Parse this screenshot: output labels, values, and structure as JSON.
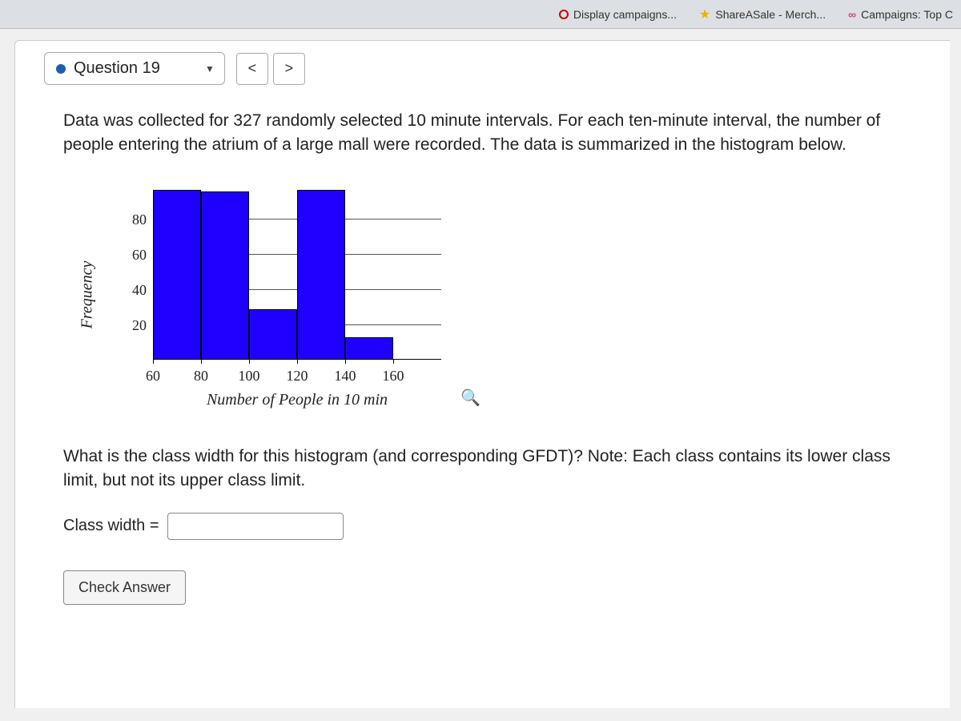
{
  "bookmarks": [
    {
      "label": "Display campaigns...",
      "icon": "circle"
    },
    {
      "label": "ShareASale - Merch...",
      "icon": "star"
    },
    {
      "label": "Campaigns: Top C",
      "icon": "inf"
    }
  ],
  "question": {
    "label": "Question 19",
    "prompt": "Data was collected for 327 randomly selected 10 minute intervals. For each ten-minute interval, the number of people entering the atrium of a large mall were recorded. The data is summarized in the histogram below.",
    "followup": "What is the class width for this histogram (and corresponding GFDT)? Note: Each class contains its lower class limit, but not its upper class limit.",
    "answer_label": "Class width =",
    "check_label": "Check Answer"
  },
  "chart_data": {
    "type": "bar",
    "title": "",
    "xlabel": "Number of People in 10 min",
    "ylabel": "Frequency",
    "ylim": [
      0,
      100
    ],
    "yticks": [
      20,
      40,
      60,
      80
    ],
    "xticks": [
      60,
      80,
      100,
      120,
      140,
      160
    ],
    "bin_edges": [
      60,
      80,
      100,
      120,
      140,
      160
    ],
    "values": [
      96,
      95,
      28,
      96,
      12
    ],
    "bar_color": "#1f00ff"
  }
}
